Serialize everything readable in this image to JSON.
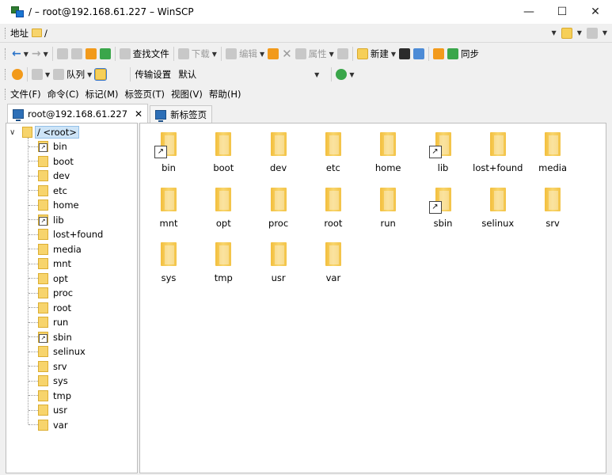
{
  "window": {
    "title": "/ – root@192.168.61.227 – WinSCP",
    "minimize": "—",
    "maximize": "☐",
    "close": "✕"
  },
  "address_bar": {
    "label": "地址",
    "path": "/"
  },
  "toolbar1": {
    "find_files": "查找文件",
    "download": "下载",
    "edit": "编辑",
    "properties": "属性",
    "new": "新建",
    "sync": "同步"
  },
  "toolbar2": {
    "queue": "队列",
    "transfer_settings_label": "传输设置",
    "transfer_settings_value": "默认"
  },
  "menu": [
    "文件(F)",
    "命令(C)",
    "标记(M)",
    "标签页(T)",
    "视图(V)",
    "帮助(H)"
  ],
  "tabs": [
    {
      "label": "root@192.168.61.227",
      "close": "✕"
    },
    {
      "label": "新标签页"
    }
  ],
  "tree": {
    "root_label": "/ <root>",
    "expander": "∨",
    "items": [
      {
        "name": "bin",
        "link": true
      },
      {
        "name": "boot",
        "link": false
      },
      {
        "name": "dev",
        "link": false
      },
      {
        "name": "etc",
        "link": false
      },
      {
        "name": "home",
        "link": false
      },
      {
        "name": "lib",
        "link": true
      },
      {
        "name": "lost+found",
        "link": false
      },
      {
        "name": "media",
        "link": false
      },
      {
        "name": "mnt",
        "link": false
      },
      {
        "name": "opt",
        "link": false
      },
      {
        "name": "proc",
        "link": false
      },
      {
        "name": "root",
        "link": false
      },
      {
        "name": "run",
        "link": false
      },
      {
        "name": "sbin",
        "link": true
      },
      {
        "name": "selinux",
        "link": false
      },
      {
        "name": "srv",
        "link": false
      },
      {
        "name": "sys",
        "link": false
      },
      {
        "name": "tmp",
        "link": false
      },
      {
        "name": "usr",
        "link": false
      },
      {
        "name": "var",
        "link": false
      }
    ]
  },
  "files": [
    {
      "name": "bin",
      "link": true
    },
    {
      "name": "boot",
      "link": false
    },
    {
      "name": "dev",
      "link": false
    },
    {
      "name": "etc",
      "link": false
    },
    {
      "name": "home",
      "link": false
    },
    {
      "name": "lib",
      "link": true
    },
    {
      "name": "lost+found",
      "link": false
    },
    {
      "name": "media",
      "link": false
    },
    {
      "name": "mnt",
      "link": false
    },
    {
      "name": "opt",
      "link": false
    },
    {
      "name": "proc",
      "link": false
    },
    {
      "name": "root",
      "link": false
    },
    {
      "name": "run",
      "link": false
    },
    {
      "name": "sbin",
      "link": true
    },
    {
      "name": "selinux",
      "link": false
    },
    {
      "name": "srv",
      "link": false
    },
    {
      "name": "sys",
      "link": false
    },
    {
      "name": "tmp",
      "link": false
    },
    {
      "name": "usr",
      "link": false
    },
    {
      "name": "var",
      "link": false
    }
  ]
}
